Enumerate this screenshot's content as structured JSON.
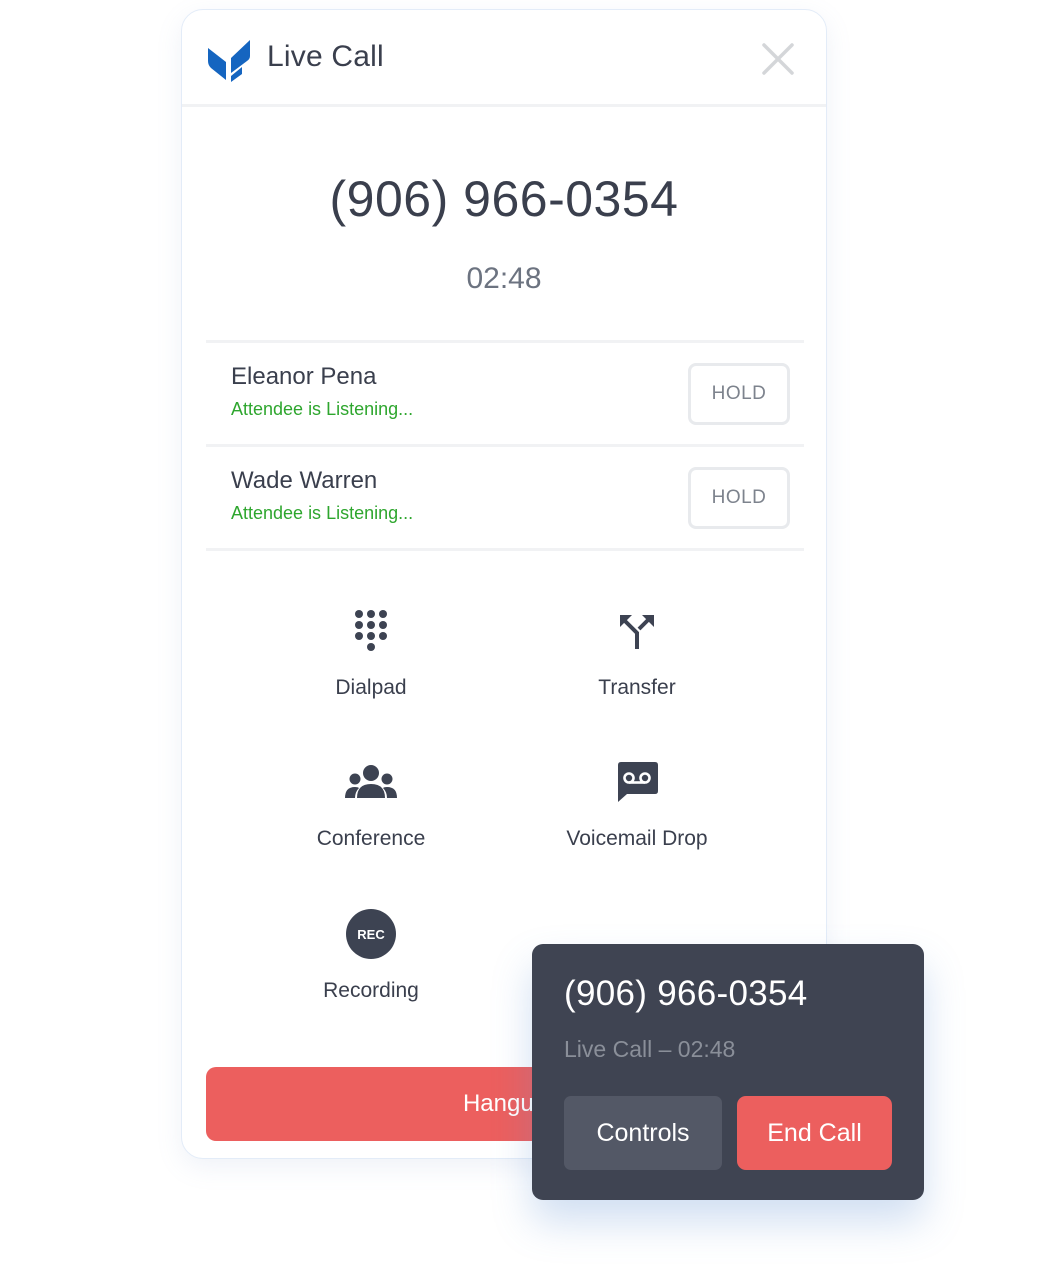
{
  "header": {
    "title": "Live Call",
    "logo_icon": "brand-leaf-logo",
    "close_icon": "close-icon"
  },
  "call": {
    "phone_number": "(906) 966-0354",
    "duration": "02:48"
  },
  "attendees": [
    {
      "name": "Eleanor Pena",
      "status": "Attendee is Listening...",
      "hold_label": "HOLD"
    },
    {
      "name": "Wade Warren",
      "status": "Attendee is Listening...",
      "hold_label": "HOLD"
    }
  ],
  "actions": [
    {
      "label": "Dialpad",
      "icon": "dialpad-icon"
    },
    {
      "label": "Transfer",
      "icon": "transfer-icon"
    },
    {
      "label": "Conference",
      "icon": "conference-icon"
    },
    {
      "label": "Voicemail Drop",
      "icon": "voicemail-icon"
    },
    {
      "label": "Recording",
      "icon": "record-icon",
      "icon_text": "REC"
    }
  ],
  "hangup_label": "Hangup",
  "mini_widget": {
    "phone_number": "(906) 966-0354",
    "status": "Live Call – 02:48",
    "controls_label": "Controls",
    "end_call_label": "End Call"
  },
  "colors": {
    "brand": "#1565c0",
    "text_dark": "#3a3f4d",
    "status_green": "#2ea62e",
    "danger": "#ec5f5e",
    "widget_bg": "#3f4452"
  }
}
